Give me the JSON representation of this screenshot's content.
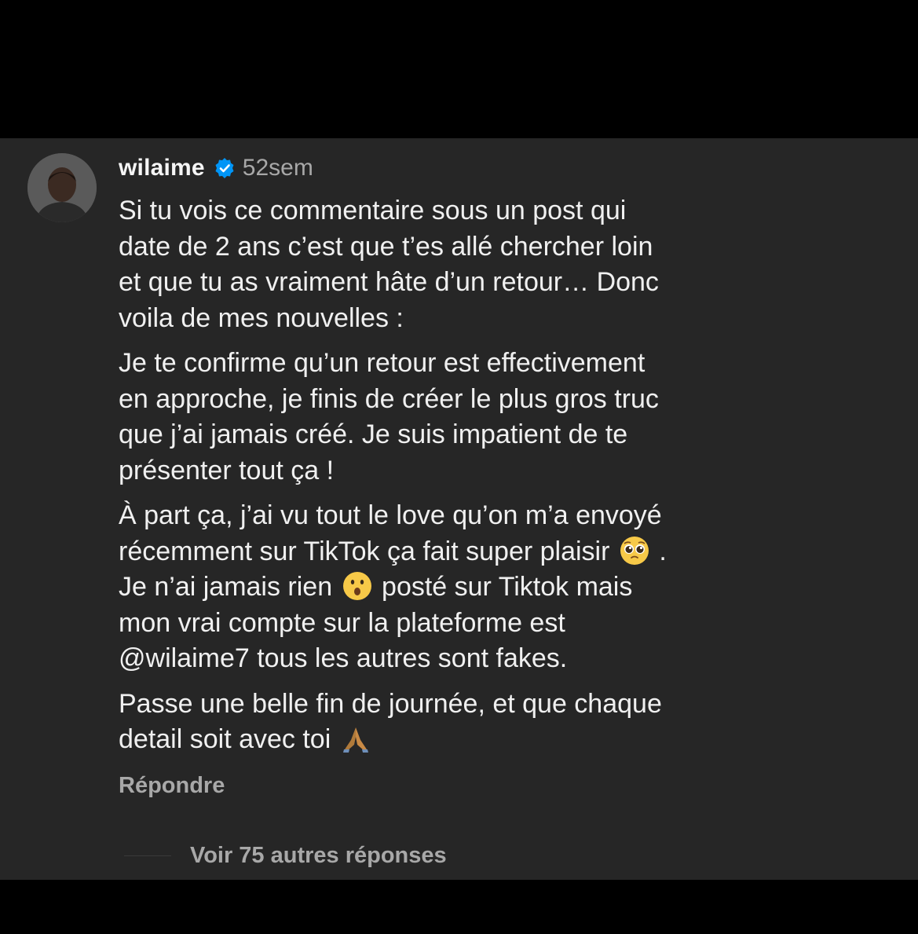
{
  "comment": {
    "username": "wilaime",
    "time": "52sem",
    "paragraphs": [
      {
        "lines": [
          "Si tu vois ce commentaire sous un post qui",
          "date de 2 ans c’est que t’es allé chercher loin",
          "et que tu as vraiment hâte d’un retour… Donc",
          "voila de mes nouvelles :"
        ]
      },
      {
        "lines": [
          "Je te confirme qu’un retour est effectivement",
          "en approche, je finis de créer le plus gros truc",
          "que j’ai jamais créé. Je suis impatient de te",
          "présenter tout ça !"
        ]
      },
      {
        "line1": "À part ça, j’ai vu tout le love qu’on m’a envoyé",
        "line2_before": "récemment sur TikTok ça fait super plaisir",
        "line2_after": ".",
        "line3_before": "Je n’ai jamais rien",
        "line3_after": "posté sur Tiktok mais",
        "line4": "mon vrai compte sur la plateforme est",
        "line5": "@wilaime7 tous les autres sont fakes."
      },
      {
        "line1": "Passe une belle fin de journée, et que chaque",
        "line2_before": "detail soit avec toi"
      }
    ],
    "reply_label": "Répondre",
    "more_replies_label": "Voir 75 autres réponses"
  },
  "icons": {
    "verified": "verified-badge-icon",
    "emoji_1": "pleading-face-emoji",
    "emoji_2": "astonished-face-emoji",
    "emoji_3": "folded-hands-emoji"
  },
  "colors": {
    "panel_background": "#262626",
    "outer_background": "#000000",
    "primary_text": "#f0f0f0",
    "secondary_text": "#a8a8a8",
    "verified_blue": "#0095f6"
  }
}
